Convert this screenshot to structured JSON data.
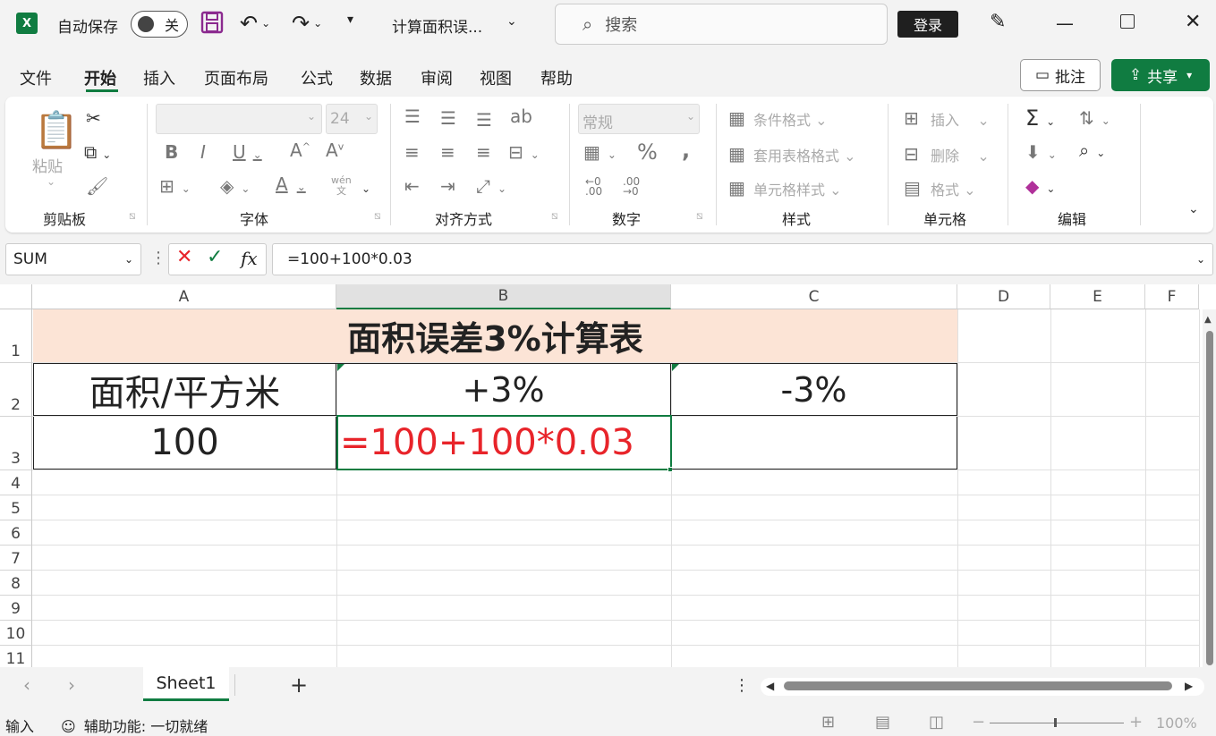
{
  "titlebar": {
    "autosave_label": "自动保存",
    "autosave_state": "关",
    "doc_title": "计算面积误...",
    "search_placeholder": "搜索",
    "login_label": "登录"
  },
  "menu": {
    "items": [
      "文件",
      "开始",
      "插入",
      "页面布局",
      "公式",
      "数据",
      "审阅",
      "视图",
      "帮助"
    ],
    "active": "开始",
    "comment_label": "批注",
    "share_label": "共享"
  },
  "ribbon": {
    "clipboard": {
      "paste_label": "粘贴",
      "group_label": "剪贴板"
    },
    "font": {
      "font_size": "24",
      "group_label": "字体",
      "phonetic": "wén",
      "phonetic_char": "文"
    },
    "alignment": {
      "group_label": "对齐方式"
    },
    "number": {
      "format": "常规",
      "group_label": "数字"
    },
    "styles": {
      "conditional": "条件格式",
      "table_format": "套用表格格式",
      "cell_style": "单元格样式",
      "group_label": "样式"
    },
    "cells": {
      "insert": "插入",
      "delete": "删除",
      "format": "格式",
      "group_label": "单元格"
    },
    "editing": {
      "group_label": "编辑"
    }
  },
  "formula_bar": {
    "name_box": "SUM",
    "formula": "=100+100*0.03"
  },
  "grid": {
    "columns": [
      "A",
      "B",
      "C",
      "D",
      "E",
      "F"
    ],
    "rows": [
      "1",
      "2",
      "3",
      "4",
      "5",
      "6",
      "7",
      "8",
      "9",
      "10",
      "11"
    ],
    "selected_column": "B",
    "cells": {
      "title": "面积误差3%计算表",
      "a2": "面积/平方米",
      "b2": "+3%",
      "c2": "-3%",
      "a3": "100",
      "b3": "=100+100*0.03"
    },
    "colors": {
      "title_fill": "#fce4d6",
      "edit_text": "#e8242a",
      "accent": "#107c41"
    }
  },
  "tabs": {
    "sheet_name": "Sheet1",
    "add_label": "+"
  },
  "status": {
    "mode": "输入",
    "accessibility": "辅助功能: 一切就绪",
    "zoom": "100%"
  }
}
